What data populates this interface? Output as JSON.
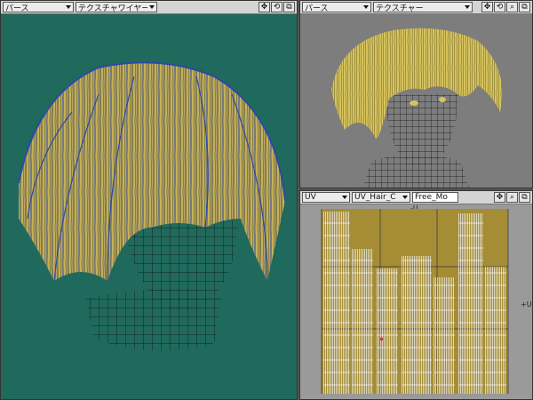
{
  "left_view": {
    "view_mode": "パース",
    "render_mode": "テクスチャワイヤー",
    "background": "#1f6a5c"
  },
  "top_right_view": {
    "view_mode": "パース",
    "render_mode": "テクスチャー",
    "background": "#7d7d7d"
  },
  "uv_view": {
    "view_mode": "UV",
    "uv_map": "UV_Hair_C",
    "mode_field": "Free_Mo",
    "axis_top": "-U",
    "axis_right": "+U",
    "background": "#9a9a9a"
  },
  "colors": {
    "hair": "#c8b45a",
    "hair_wire": "#2a4aa8",
    "mesh_wire": "#111111"
  },
  "icons": [
    "move-icon",
    "rotate-icon",
    "zoom-icon",
    "maximize-icon"
  ]
}
